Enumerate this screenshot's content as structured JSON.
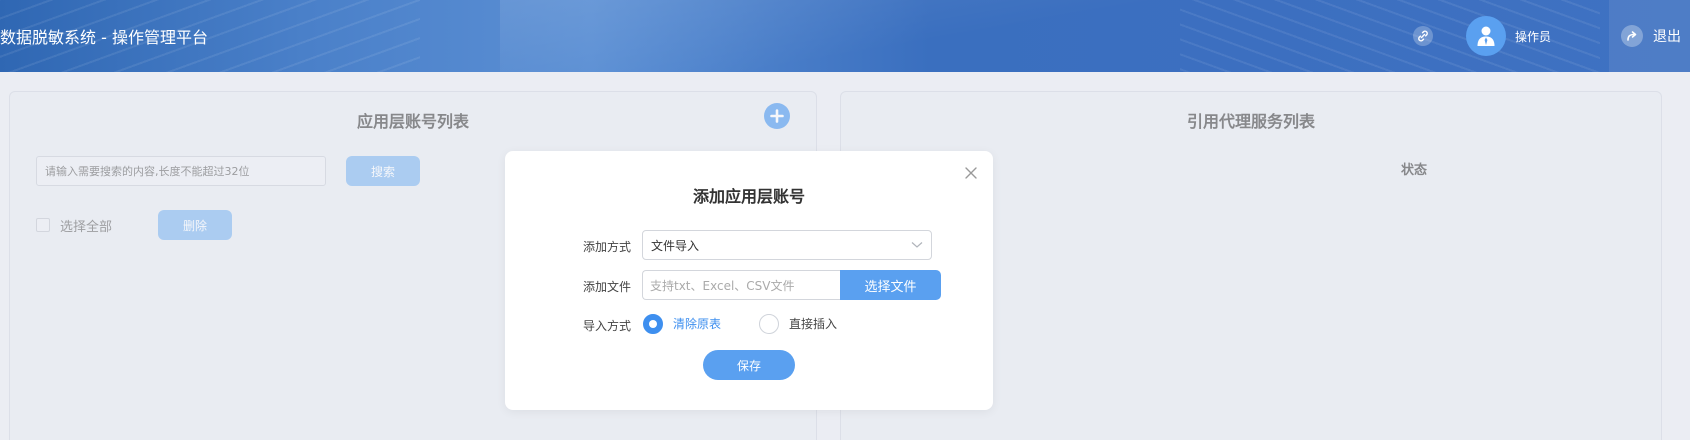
{
  "header": {
    "app_title": "数据脱敏系统 - 操作管理平台",
    "operator_name": "操作员",
    "logout_label": "退出"
  },
  "left_panel": {
    "title": "应用层账号列表",
    "search_placeholder": "请输入需要搜索的内容,长度不能超过32位",
    "search_button": "搜索",
    "select_all_label": "选择全部",
    "delete_button": "删除"
  },
  "right_panel": {
    "title": "引用代理服务列表",
    "status_column": "状态"
  },
  "modal": {
    "title": "添加应用层账号",
    "method_label": "添加方式",
    "method_value": "文件导入",
    "file_label": "添加文件",
    "file_placeholder": "支持txt、Excel、CSV文件",
    "file_button": "选择文件",
    "import_label": "导入方式",
    "import_options": [
      {
        "label": "清除原表",
        "selected": true
      },
      {
        "label": "直接插入",
        "selected": false
      }
    ],
    "save_button": "保存"
  },
  "colors": {
    "accent": "#5aa0f0",
    "header_blue": "#3c6fc0",
    "selected_text": "#3e8fef"
  }
}
